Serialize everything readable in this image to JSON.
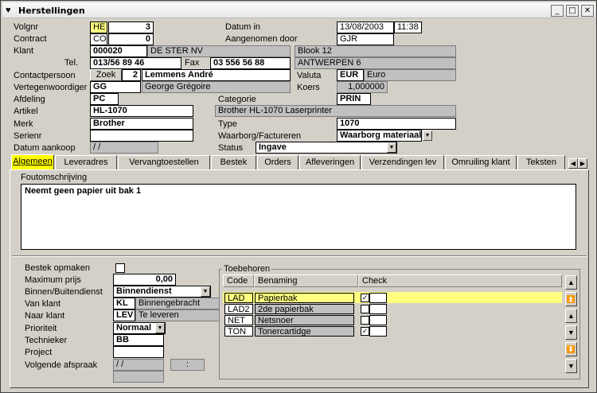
{
  "window": {
    "title": "Herstellingen",
    "min": "_",
    "max": "□",
    "close": "✕"
  },
  "header": {
    "volgnr": {
      "label": "Volgnr",
      "code": "HE",
      "num": "3"
    },
    "datum_in": {
      "label": "Datum in",
      "date": "13/08/2003",
      "time": "11:38"
    },
    "contract": {
      "label": "Contract",
      "code": "CO",
      "num": "0"
    },
    "aangenomen": {
      "label": "Aangenomen door",
      "value": "GJR"
    },
    "klant": {
      "label": "Klant",
      "code": "000020",
      "name": "DE STER NV",
      "addr1": "Blook 12",
      "addr2": "ANTWERPEN 6"
    },
    "tel": {
      "label": "Tel.",
      "value": "013/56 89 46"
    },
    "fax": {
      "label": "Fax",
      "value": "03 556 56 88"
    },
    "contactpersoon": {
      "label": "Contactpersoon",
      "zoek": "Zoek",
      "num": "2",
      "name": "Lemmens André"
    },
    "valuta": {
      "label": "Valuta",
      "code": "EUR",
      "name": "Euro"
    },
    "vertegenwoordiger": {
      "label": "Vertegenwoordiger",
      "code": "GG",
      "name": "George Grégoire"
    },
    "koers": {
      "label": "Koers",
      "value": "1,000000"
    },
    "afdeling": {
      "label": "Afdeling",
      "value": "PC"
    },
    "categorie": {
      "label": "Categorie",
      "value": "PRIN"
    },
    "artikel": {
      "label": "Artikel",
      "value": "HL-1070",
      "desc": "Brother HL-1070 Laserprinter"
    },
    "merk": {
      "label": "Merk",
      "value": "Brother"
    },
    "type": {
      "label": "Type",
      "value": "1070"
    },
    "serienr": {
      "label": "Serienr",
      "value": ""
    },
    "waarborg": {
      "label": "Waarborg/Factureren",
      "value": "Waarborg materiaal"
    },
    "datum_aankoop": {
      "label": "Datum aankoop",
      "value": "  /  /"
    },
    "status": {
      "label": "Status",
      "value": "Ingave"
    }
  },
  "tabs": [
    "Algemeen",
    "Leveradres",
    "Vervangtoestellen",
    "Bestek",
    "Orders",
    "Afleveringen",
    "Verzendingen lev",
    "Omruiling klant",
    "Teksten"
  ],
  "foutomschrijving": {
    "label": "Foutomschrijving",
    "text": "Neemt geen papier uit bak 1"
  },
  "lower": {
    "bestek": {
      "label": "Bestek opmaken"
    },
    "max_prijs": {
      "label": "Maximum prijs",
      "value": "0,00"
    },
    "binnen": {
      "label": "Binnen/Buitendienst",
      "value": "Binnendienst"
    },
    "van_klant": {
      "label": "Van klant",
      "code": "KL",
      "name": "Binnengebracht"
    },
    "naar_klant": {
      "label": "Naar klant",
      "code": "LEV",
      "name": "Te leveren"
    },
    "prioriteit": {
      "label": "Prioriteit",
      "value": "Normaal"
    },
    "technieker": {
      "label": "Technieker",
      "value": "BB"
    },
    "project": {
      "label": "Project",
      "value": ""
    },
    "afspraak": {
      "label": "Volgende afspraak",
      "date": "  /  /",
      "time": ":"
    }
  },
  "toebehoren": {
    "label": "Toebehoren",
    "columns": [
      "Code",
      "Benaming",
      "Check"
    ],
    "rows": [
      {
        "code": "LAD",
        "name": "Papierbak",
        "checked": true
      },
      {
        "code": "LAD2",
        "name": "2de papierbak",
        "checked": false
      },
      {
        "code": "NET",
        "name": "Netsnoer",
        "checked": false
      },
      {
        "code": "TON",
        "name": "Tonercartidge",
        "checked": true
      }
    ]
  },
  "colors": {
    "highlight": "#ffff00",
    "field_highlight": "#ffff80",
    "readonly": "#c0c0c0",
    "face": "#d4d0c8"
  }
}
